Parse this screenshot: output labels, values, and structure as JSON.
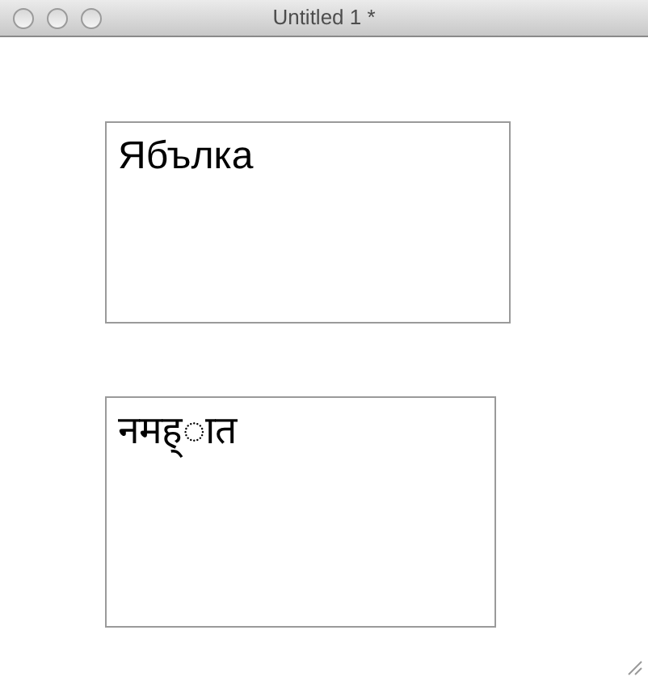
{
  "window": {
    "title": "Untitled 1 *"
  },
  "text_boxes": [
    {
      "text": "Ябълка"
    },
    {
      "text": "नमह्ात"
    }
  ]
}
